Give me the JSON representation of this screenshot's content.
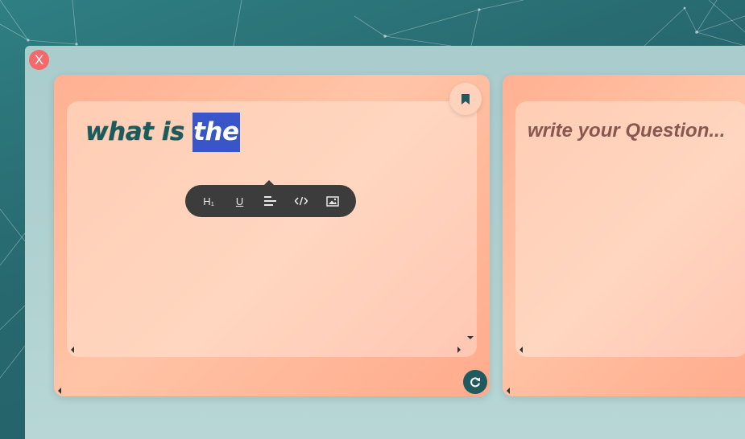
{
  "window": {
    "close_label": "X"
  },
  "cards": [
    {
      "question_text": "what is ",
      "question_selected": "the",
      "toolbar": {
        "items": [
          {
            "label": "H₁",
            "icon": "heading-icon"
          },
          {
            "label": "U",
            "icon": "underline-icon"
          },
          {
            "label": "",
            "icon": "align-icon"
          },
          {
            "label": "",
            "icon": "code-icon"
          },
          {
            "label": "",
            "icon": "image-icon"
          }
        ]
      },
      "bookmark_icon": "bookmark-icon",
      "refresh_icon": "refresh-icon"
    },
    {
      "placeholder": "write your Question..."
    }
  ],
  "colors": {
    "card_bg": "#ffb092",
    "editor_bg": "#ffd6c0",
    "question_text": "#1d5a5c",
    "selection": "#3a55c9",
    "toolbar_bg": "#3c3c3c",
    "close_button": "#f46a6a",
    "refresh_button": "#1e5a5e"
  }
}
